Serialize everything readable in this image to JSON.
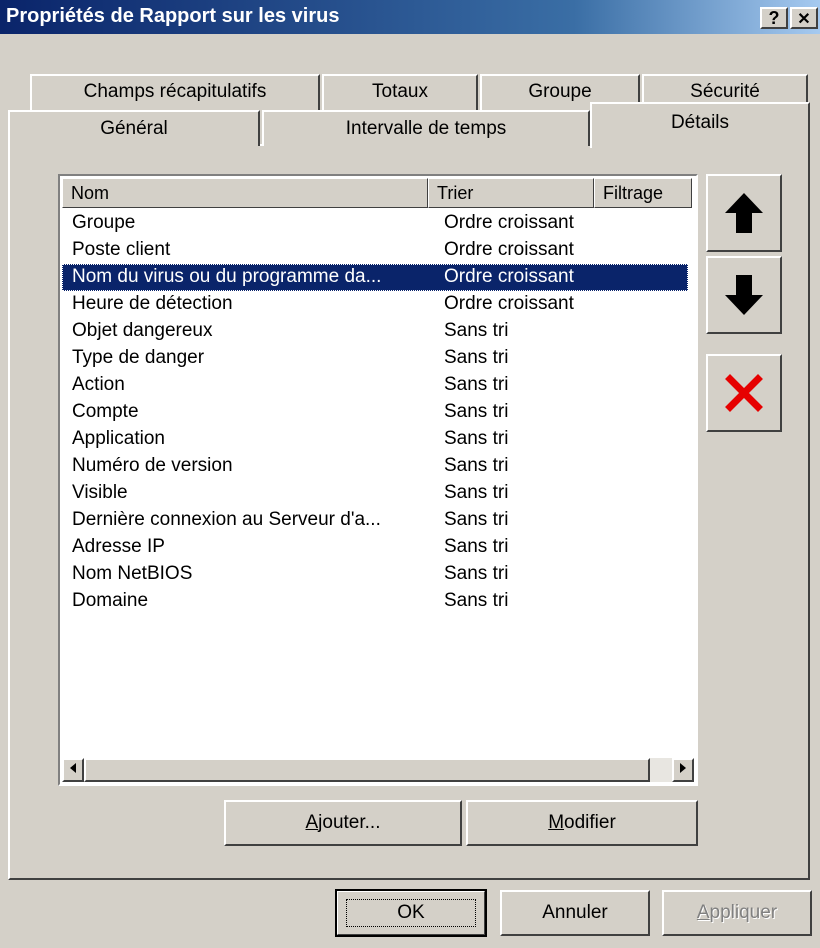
{
  "window": {
    "title": "Propriétés de Rapport sur les virus",
    "help_label": "?",
    "close_label": "✕"
  },
  "tabs_back": [
    {
      "label": "Champs récapitulatifs"
    },
    {
      "label": "Totaux"
    },
    {
      "label": "Groupe"
    },
    {
      "label": "Sécurité"
    }
  ],
  "tabs_front": [
    {
      "label": "Général"
    },
    {
      "label": "Intervalle de temps"
    },
    {
      "label": "Détails",
      "active": true
    }
  ],
  "list": {
    "columns": [
      "Nom",
      "Trier",
      "Filtrage"
    ],
    "rows": [
      {
        "name": "Groupe",
        "sort": "Ordre croissant"
      },
      {
        "name": "Poste client",
        "sort": "Ordre croissant"
      },
      {
        "name": "Nom du virus ou du programme da...",
        "sort": "Ordre croissant",
        "selected": true
      },
      {
        "name": "Heure de détection",
        "sort": "Ordre croissant"
      },
      {
        "name": "Objet dangereux",
        "sort": "Sans tri"
      },
      {
        "name": "Type de danger",
        "sort": "Sans tri"
      },
      {
        "name": "Action",
        "sort": "Sans tri"
      },
      {
        "name": "Compte",
        "sort": "Sans tri"
      },
      {
        "name": "Application",
        "sort": "Sans tri"
      },
      {
        "name": "Numéro de version",
        "sort": "Sans tri"
      },
      {
        "name": "Visible",
        "sort": "Sans tri"
      },
      {
        "name": "Dernière connexion au Serveur d'a...",
        "sort": "Sans tri"
      },
      {
        "name": "Adresse IP",
        "sort": "Sans tri"
      },
      {
        "name": "Nom NetBIOS",
        "sort": "Sans tri"
      },
      {
        "name": "Domaine",
        "sort": "Sans tri"
      }
    ]
  },
  "side_buttons": {
    "up": "arrow-up-icon",
    "down": "arrow-down-icon",
    "delete": "delete-x-icon",
    "delete_color": "#e60000"
  },
  "actions": {
    "add_mnemonic": "A",
    "add_rest": "jouter...",
    "modify_mnemonic": "M",
    "modify_rest": "odifier"
  },
  "footer": {
    "ok": "OK",
    "cancel": "Annuler",
    "apply_mnemonic": "A",
    "apply_rest": "ppliquer"
  }
}
